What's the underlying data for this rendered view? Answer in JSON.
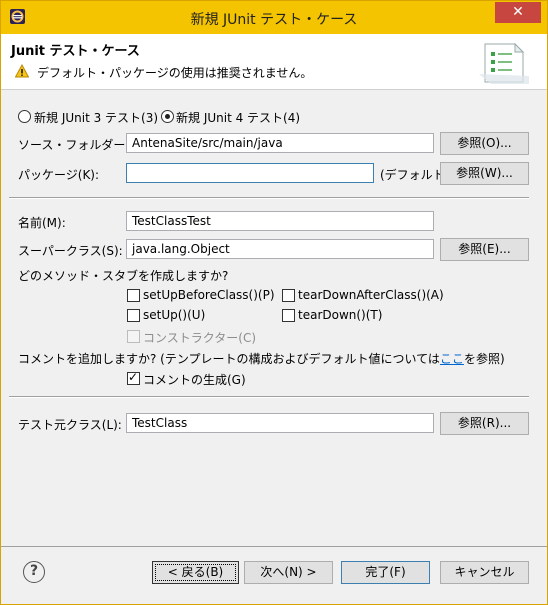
{
  "window": {
    "title": "新規 JUnit テスト・ケース",
    "close": "✕"
  },
  "banner": {
    "title": "Junit テスト・ケース",
    "message": "デフォルト・パッケージの使用は推奨されません。"
  },
  "radios": {
    "junit3": "新規 JUnit 3 テスト(3)",
    "junit4": "新規 JUnit 4 テスト(4)"
  },
  "source_folder": {
    "label": "ソース・フォルダー(D):",
    "value": "AntenaSite/src/main/java",
    "browse": "参照(O)..."
  },
  "package": {
    "label": "パッケージ(K):",
    "value": "",
    "default_note": "(デフォルト)",
    "browse": "参照(W)..."
  },
  "name": {
    "label": "名前(M):",
    "value": "TestClassTest"
  },
  "superclass": {
    "label": "スーパークラス(S):",
    "value": "java.lang.Object",
    "browse": "参照(E)..."
  },
  "stubs": {
    "question": "どのメソッド・スタブを作成しますか?",
    "setUpBeforeClass": "setUpBeforeClass()(P)",
    "tearDownAfterClass": "tearDownAfterClass()(A)",
    "setUp": "setUp()(U)",
    "tearDown": "tearDown()(T)",
    "constructor": "コンストラクター(C)"
  },
  "comments": {
    "question_before": "コメントを追加しますか? (テンプレートの構成およびデフォルト値については",
    "link": "ここ",
    "question_after": "を参照)",
    "generate": "コメントの生成(G)"
  },
  "class_under_test": {
    "label": "テスト元クラス(L):",
    "value": "TestClass",
    "browse": "参照(R)..."
  },
  "buttons": {
    "back": "< 戻る(B)",
    "next": "次へ(N) >",
    "finish": "完了(F)",
    "cancel": "キャンセル",
    "help": "?"
  }
}
